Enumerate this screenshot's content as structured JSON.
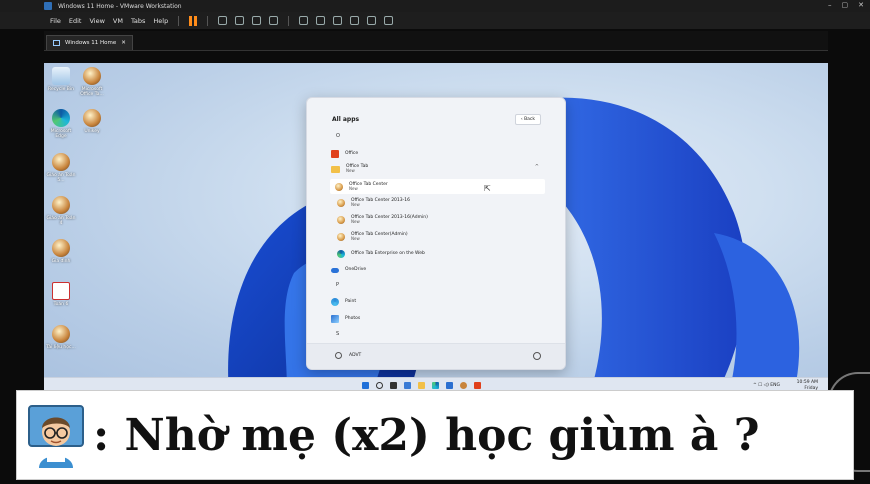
{
  "window": {
    "title": "Windows 11 Home - VMware Workstation",
    "controls": [
      "–",
      "▢",
      "✕"
    ]
  },
  "menu": {
    "items": [
      "File",
      "Edit",
      "View",
      "VM",
      "Tabs",
      "Help"
    ]
  },
  "vm_tab": {
    "label": "Windows 11 Home",
    "close": "✕"
  },
  "desktop_icons": [
    {
      "label": "Recycle Bin",
      "icon": "recycle-bin-icon"
    },
    {
      "label": "Microsoft Office Ta...",
      "icon": "office-tab-icon"
    },
    {
      "label": "Microsoft Edge",
      "icon": "edge-icon"
    },
    {
      "label": "Unikey",
      "icon": "unikey-icon"
    },
    {
      "label": "Giáo án Toán 5...",
      "icon": "doc-icon"
    },
    {
      "label": "Giáo án Toán 4",
      "icon": "doc-icon"
    },
    {
      "label": "Gia đình",
      "icon": "folder-icon"
    },
    {
      "label": "Toán 6",
      "icon": "doc-icon"
    },
    {
      "label": "Tài liệu học...",
      "icon": "doc-icon"
    }
  ],
  "start": {
    "header": "All apps",
    "back_label": "‹  Back",
    "letters": {
      "o": "O",
      "p": "P",
      "s": "S"
    },
    "apps": [
      {
        "name": "Office",
        "sub": ""
      },
      {
        "name": "Office Tab",
        "sub": "New"
      },
      {
        "name": "Office Tab Center",
        "sub": "New"
      },
      {
        "name": "Office Tab Center 2013-16",
        "sub": "New"
      },
      {
        "name": "Office Tab Center 2013-16(Admin)",
        "sub": "New"
      },
      {
        "name": "Office Tab Center(Admin)",
        "sub": "New"
      },
      {
        "name": "Office Tab Enterprise on the Web",
        "sub": ""
      },
      {
        "name": "OneDrive",
        "sub": ""
      },
      {
        "name": "Paint",
        "sub": ""
      },
      {
        "name": "Photos",
        "sub": ""
      }
    ],
    "user": "ADVT"
  },
  "taskbar": {
    "tray_left": "^ ☐ ◁) ENG",
    "time": "10:59 AM",
    "day": "Friday"
  },
  "caption": {
    "text": ": Nhờ mẹ (x2) học giùm à ?"
  }
}
